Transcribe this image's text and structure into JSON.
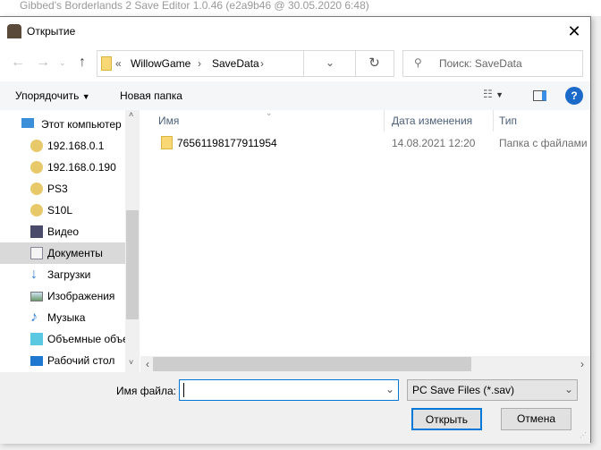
{
  "background_app": {
    "title": "Gibbed's Borderlands 2 Save Editor 1.0.46 (e2a9b46 @ 30.05.2020 6:48)"
  },
  "dialog": {
    "title": "Открытие"
  },
  "nav": {
    "breadcrumb": [
      "WillowGame",
      "SaveData"
    ],
    "overflow": "«",
    "search_placeholder": "Поиск: SaveData"
  },
  "toolbar": {
    "organize": "Упорядочить",
    "new_folder": "Новая папка"
  },
  "sidebar": {
    "items": [
      {
        "label": "Этот компьютер",
        "icon": "computer-icon"
      },
      {
        "label": "192.168.0.1",
        "icon": "network-drive-icon"
      },
      {
        "label": "192.168.0.190",
        "icon": "network-drive-icon"
      },
      {
        "label": "PS3",
        "icon": "network-drive-icon"
      },
      {
        "label": "S10L",
        "icon": "network-drive-icon"
      },
      {
        "label": "Видео",
        "icon": "video-icon"
      },
      {
        "label": "Документы",
        "icon": "documents-icon",
        "selected": true
      },
      {
        "label": "Загрузки",
        "icon": "downloads-icon"
      },
      {
        "label": "Изображения",
        "icon": "pictures-icon"
      },
      {
        "label": "Музыка",
        "icon": "music-icon"
      },
      {
        "label": "Объемные объекты",
        "icon": "3d-objects-icon"
      },
      {
        "label": "Рабочий стол",
        "icon": "desktop-icon"
      }
    ]
  },
  "columns": {
    "name": "Имя",
    "date": "Дата изменения",
    "type": "Тип"
  },
  "files": [
    {
      "name": "76561198177911954",
      "date": "14.08.2021 12:20",
      "type": "Папка с файлами"
    }
  ],
  "bottom": {
    "filename_label": "Имя файла:",
    "filename_value": "",
    "filter": "PC Save Files (*.sav)",
    "open": "Открыть",
    "cancel": "Отмена"
  }
}
